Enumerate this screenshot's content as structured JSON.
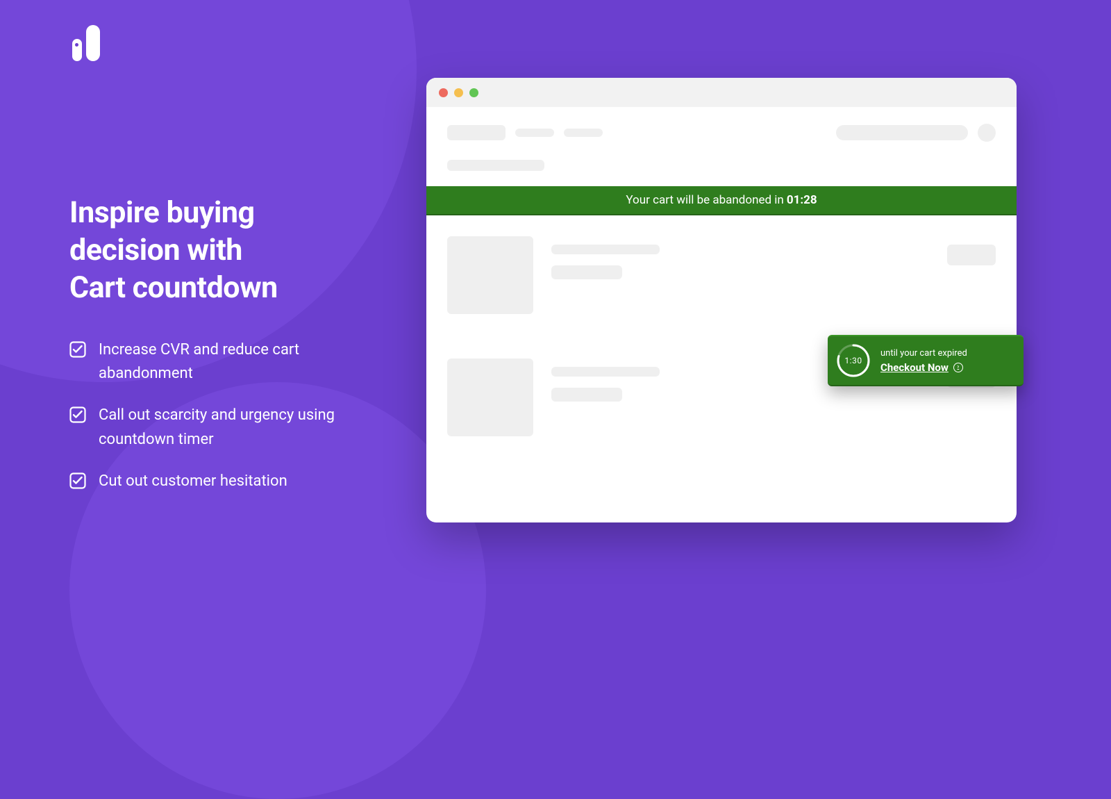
{
  "colors": {
    "bg": "#6b3fcf",
    "accent": "#2f7d1e"
  },
  "headline_l1": "Inspire buying",
  "headline_l2": "decision with",
  "headline_l3": "Cart countdown",
  "bullets": [
    "Increase CVR and reduce cart abandonment",
    "Call out scarcity and urgency using countdown timer",
    "Cut out customer hesitation"
  ],
  "banner": {
    "prefix": "Your cart will be abandoned in",
    "time": "01:28"
  },
  "widget": {
    "ring_time": "1:30",
    "line1": "until your cart expired",
    "cta": "Checkout Now"
  }
}
